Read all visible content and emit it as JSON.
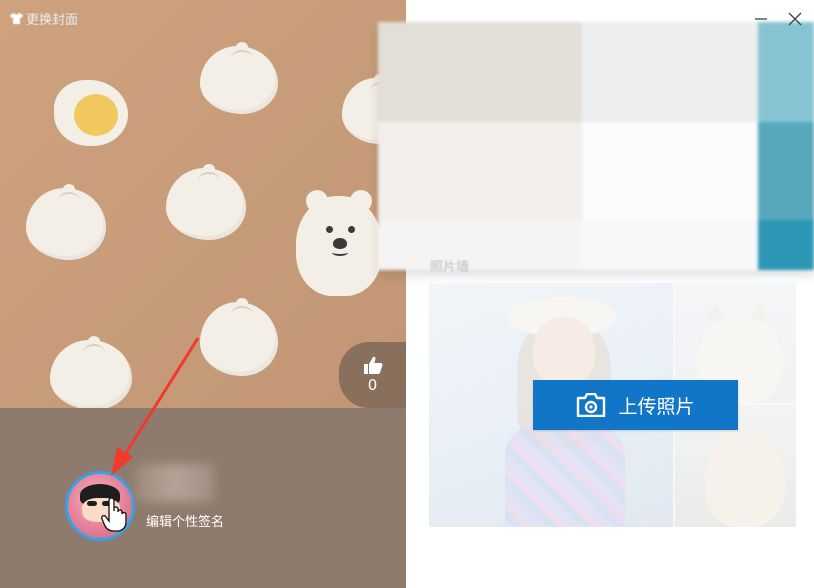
{
  "cover": {
    "change_cover_label": "更换封面",
    "like_count": "0"
  },
  "profile": {
    "edit_signature_label": "编辑个性签名"
  },
  "right_panel": {
    "section_label": "照片墙",
    "upload_button_label": "上传照片"
  },
  "window": {
    "minimize_icon": "minimize-icon",
    "close_icon": "close-icon"
  },
  "colors": {
    "cover_bg": "#c99e7c",
    "profile_bg": "#8f7b6d",
    "upload_button": "#1175c8",
    "avatar_ring": "#3aa0e8",
    "annotation_arrow": "#f03a2e"
  }
}
